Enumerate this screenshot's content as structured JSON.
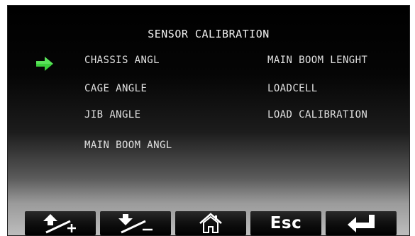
{
  "screen": {
    "title": "SENSOR CALIBRATION"
  },
  "menu": {
    "left": [
      {
        "label": "CHASSIS ANGL"
      },
      {
        "label": "CAGE ANGLE"
      },
      {
        "label": "JIB ANGLE"
      },
      {
        "label": "MAIN BOOM ANGL"
      }
    ],
    "right": [
      {
        "label": "MAIN BOOM LENGHT"
      },
      {
        "label": "LOADCELL"
      },
      {
        "label": "LOAD CALIBRATION"
      }
    ],
    "selected_item": "CHASSIS ANGL",
    "selector_icon": "green-arrow-right-icon",
    "selector_color": "#3cd03c"
  },
  "toolbar": {
    "buttons": [
      {
        "icon": "up-plus-icon"
      },
      {
        "icon": "down-minus-icon"
      },
      {
        "icon": "home-icon"
      },
      {
        "label": "Esc"
      },
      {
        "icon": "enter-return-icon"
      }
    ]
  },
  "colors": {
    "text": "#e0e0e0",
    "title_text": "#f2f2f2",
    "selector": "#3cd03c",
    "button_bg": "#000000"
  }
}
